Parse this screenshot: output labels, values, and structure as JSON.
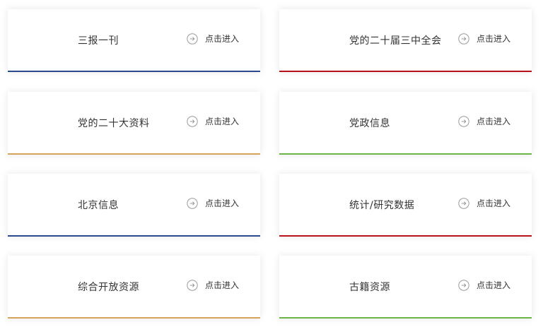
{
  "cards": [
    {
      "title": "三报一刊",
      "enter_label": "点击进入",
      "accent": "#2b4a8c"
    },
    {
      "title": "党的二十届三中全会",
      "enter_label": "点击进入",
      "accent": "#b8121b"
    },
    {
      "title": "党的二十大资料",
      "enter_label": "点击进入",
      "accent": "#d6a35b"
    },
    {
      "title": "党政信息",
      "enter_label": "点击进入",
      "accent": "#6db24a"
    },
    {
      "title": "北京信息",
      "enter_label": "点击进入",
      "accent": "#2b4a8c"
    },
    {
      "title": "统计/研究数据",
      "enter_label": "点击进入",
      "accent": "#b8121b"
    },
    {
      "title": "综合开放资源",
      "enter_label": "点击进入",
      "accent": "#d6a35b"
    },
    {
      "title": "古籍资源",
      "enter_label": "点击进入",
      "accent": "#6db24a"
    }
  ],
  "icons": {
    "enter": "arrow-circle-right-icon"
  }
}
